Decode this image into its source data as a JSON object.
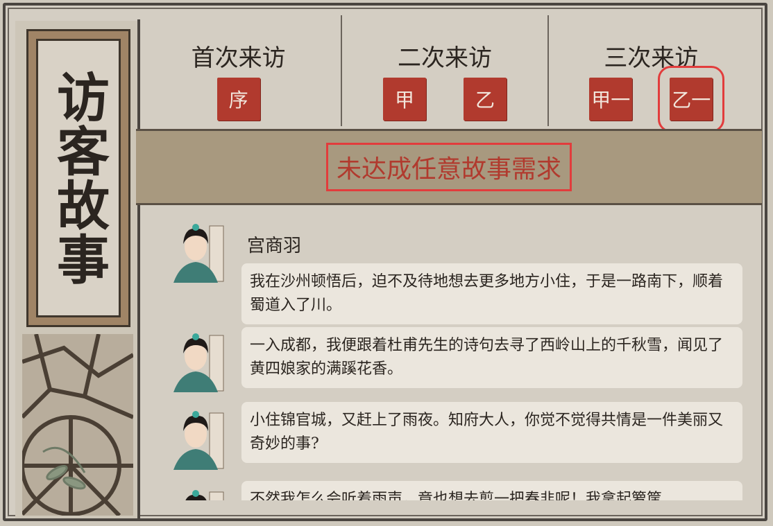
{
  "side_title": "访客故事",
  "visits": [
    {
      "label": "首次来访",
      "seals": [
        "序"
      ]
    },
    {
      "label": "二次来访",
      "seals": [
        "甲",
        "乙"
      ]
    },
    {
      "label": "三次来访",
      "seals": [
        "甲一",
        "乙一"
      ]
    }
  ],
  "selected_seal": "乙一",
  "banner": "未达成任意故事需求",
  "speaker": "宫商羽",
  "messages": [
    "我在沙州顿悟后，迫不及待地想去更多地方小住，于是一路南下，顺着蜀道入了川。",
    "一入成都，我便跟着杜甫先生的诗句去寻了西岭山上的千秋雪，闻见了黄四娘家的满蹊花香。",
    "小住锦官城，又赶上了雨夜。知府大人，你觉不觉得共情是一件美丽又奇妙的事?",
    "不然我怎么会听着雨声，竟也想去剪一把春韭呢！我拿起箩筐"
  ],
  "colors": {
    "seal": "#b13a2e",
    "banner_bg": "#a8997f",
    "highlight": "#e23c3c"
  }
}
